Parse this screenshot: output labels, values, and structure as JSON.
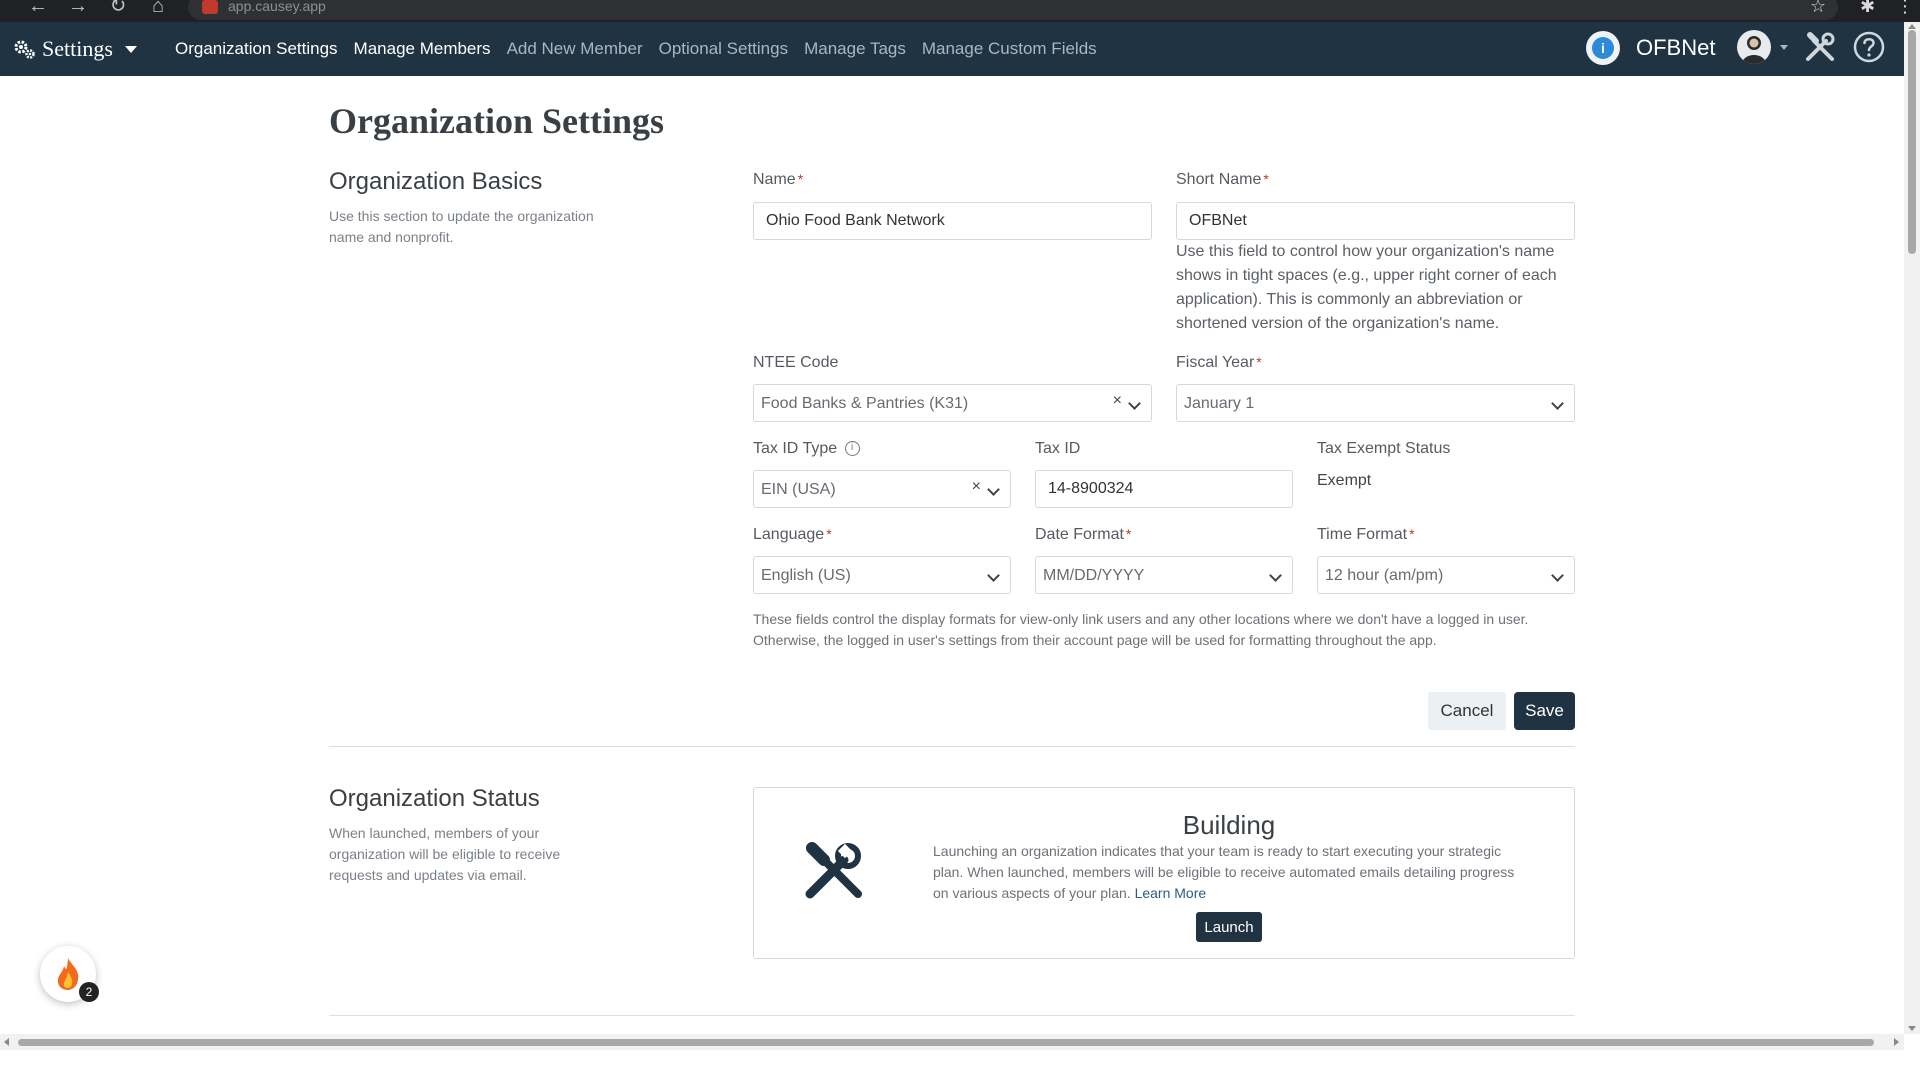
{
  "browser": {
    "url": "app.causey.app"
  },
  "nav": {
    "brand": "Settings",
    "links": [
      "Organization Settings",
      "Manage Members",
      "Add New Member",
      "Optional Settings",
      "Manage Tags",
      "Manage Custom Fields"
    ],
    "org_short": "OFBNet"
  },
  "page_title": "Organization Settings",
  "basics": {
    "title": "Organization Basics",
    "desc": "Use this section to update the organization name and nonprofit.",
    "name_label": "Name",
    "name_value": "Ohio Food Bank Network",
    "short_label": "Short Name",
    "short_value": "OFBNet",
    "short_help": "Use this field to control how your organization's name shows in tight spaces (e.g., upper right corner of each application). This is commonly an abbreviation or shortened version of the organization's name.",
    "ntee_label": "NTEE Code",
    "ntee_value": "Food Banks & Pantries (K31)",
    "fiscal_label": "Fiscal Year",
    "fiscal_value": "January 1",
    "taxtype_label": "Tax ID Type",
    "taxtype_value": "EIN (USA)",
    "taxid_label": "Tax ID",
    "taxid_value": "14-8900324",
    "exempt_label": "Tax Exempt Status",
    "exempt_value": "Exempt",
    "lang_label": "Language",
    "lang_value": "English (US)",
    "date_label": "Date Format",
    "date_value": "MM/DD/YYYY",
    "time_label": "Time Format",
    "time_value": "12 hour (am/pm)",
    "format_note": "These fields control the display formats for view-only link users and any other locations where we don't have a logged in user. Otherwise, the logged in user's settings from their account page will be used for formatting throughout the app.",
    "cancel": "Cancel",
    "save": "Save"
  },
  "status": {
    "title": "Organization Status",
    "desc": "When launched, members of your organization will be eligible to receive requests and updates via email.",
    "card_title": "Building",
    "card_text": "Launching an organization indicates that your team is ready to start executing your strategic plan. When launched, members will be eligible to receive automated emails detailing progress on various aspects of your plan.",
    "learn_more": "Learn More",
    "launch": "Launch"
  },
  "fab": {
    "badge": "2"
  },
  "colors": {
    "nav_bg": "#1f3343",
    "primary_btn": "#1f3343",
    "required": "#c0392b"
  }
}
